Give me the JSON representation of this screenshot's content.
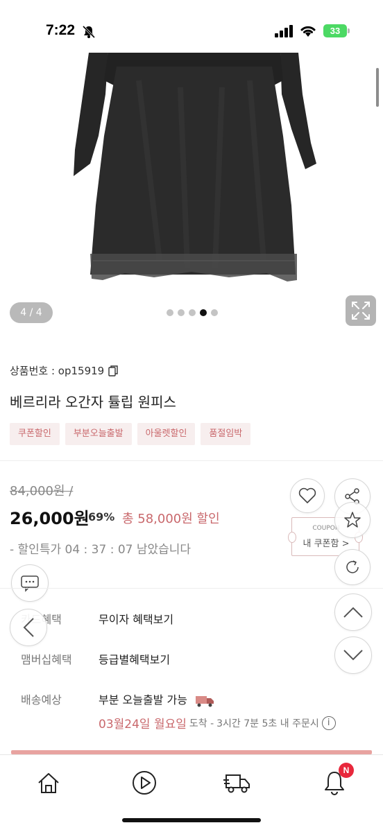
{
  "status_bar": {
    "time": "7:22",
    "battery": "33"
  },
  "gallery": {
    "counter": "4 / 4",
    "total_dots": 5,
    "active_dot_index": 3
  },
  "product": {
    "code_label": "상품번호 : op15919",
    "name": "베르리라 오간자 튤립 원피스",
    "tags": [
      "쿠폰할인",
      "부분오늘출발",
      "아울렛할인",
      "품절임박"
    ]
  },
  "pricing": {
    "original": "84,000원 /",
    "price": "26,000원",
    "discount_pct": "69%",
    "total_discount": "총 58,000원 할인",
    "countdown": "- 할인특가 04 : 37 : 07 남았습니다"
  },
  "coupon": {
    "top": "COUPON",
    "bottom": "내 쿠폰함 >"
  },
  "benefits": [
    {
      "label": "카드혜택",
      "value": "무이자 혜택보기"
    },
    {
      "label": "맴버십혜택",
      "value": "등급별혜택보기"
    },
    {
      "label": "배송예상",
      "value": "부분 오늘출발 가능"
    }
  ],
  "delivery": {
    "date": "03월24일 월요일",
    "arrive": "도착 -",
    "time": "3시간 7분 5초 내 주문시",
    "info": "i"
  },
  "nav": {
    "badge": "N"
  },
  "icons": [
    "bell-off-icon",
    "signal-icon",
    "wifi-icon",
    "expand-icon",
    "copy-icon",
    "heart-icon",
    "share-icon",
    "star-icon",
    "refresh-icon",
    "chevron-up-icon",
    "chevron-down-icon",
    "chat-icon",
    "chevron-left-icon",
    "truck-icon",
    "home-icon",
    "play-icon",
    "bell-icon"
  ],
  "colors": {
    "accent": "#c9686c",
    "tag_bg": "#f7eeee",
    "bar": "#e8a3a0",
    "badge": "#e8283c"
  }
}
